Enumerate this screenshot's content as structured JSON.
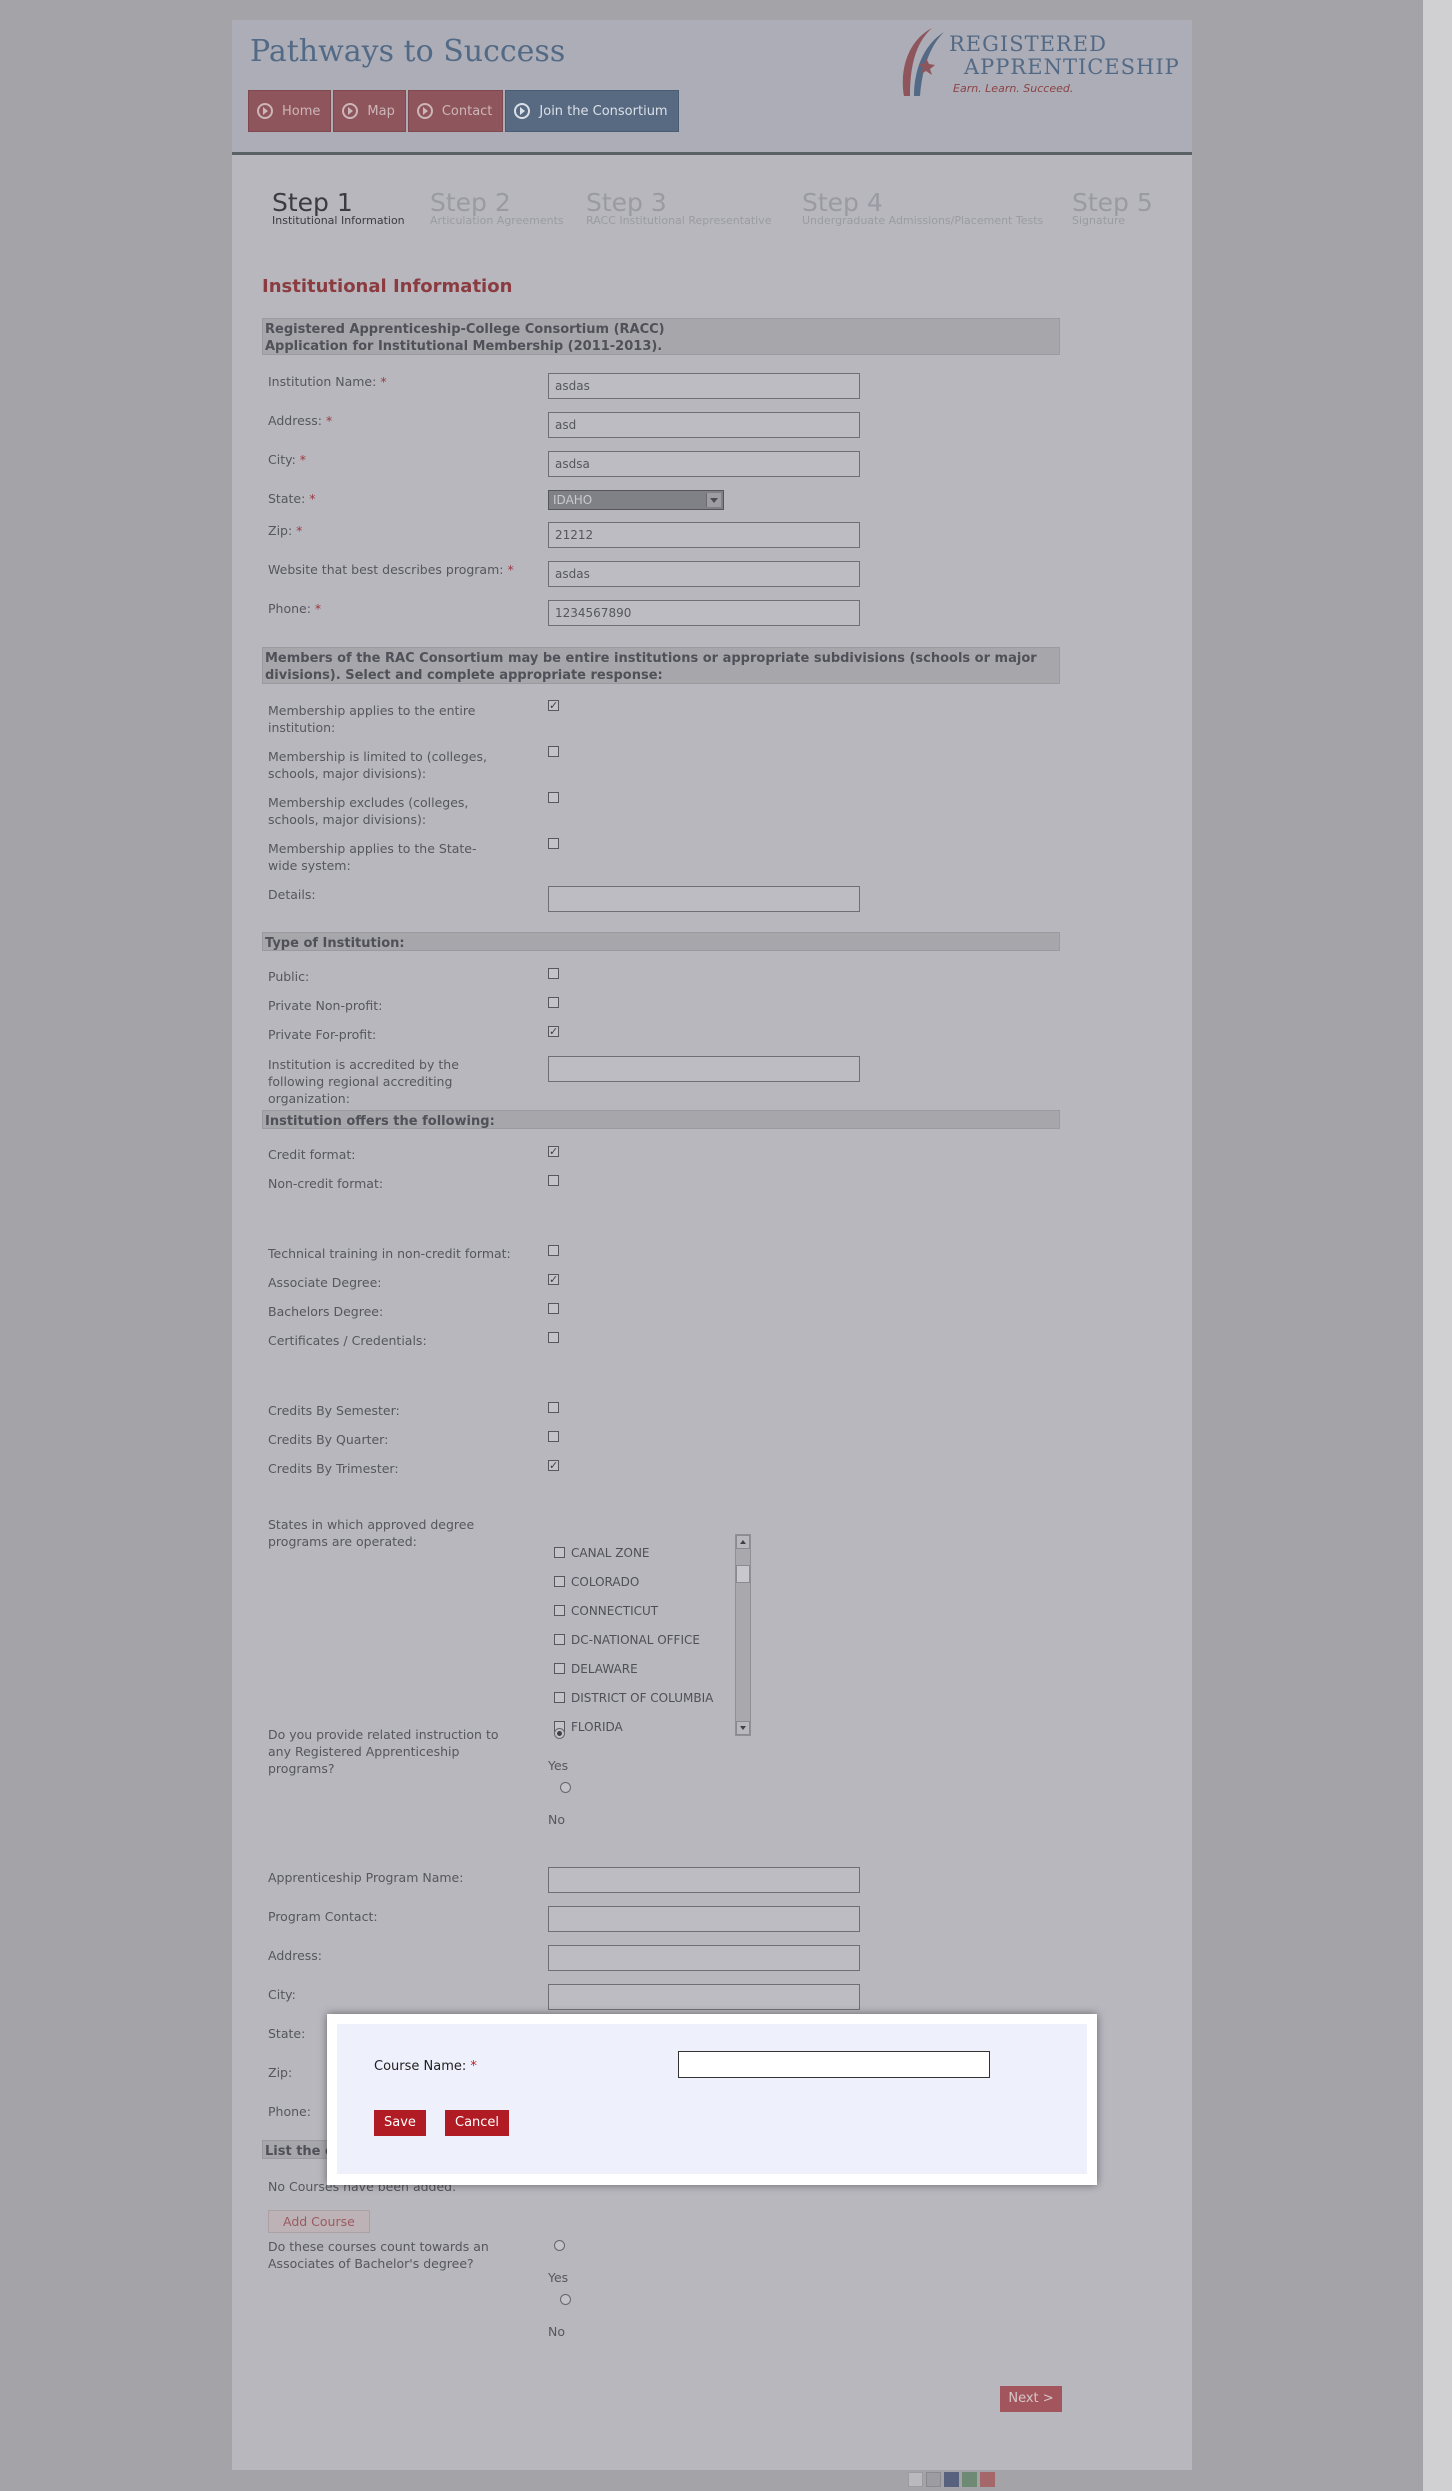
{
  "site": {
    "title": "Pathways to Success"
  },
  "logo": {
    "line1": "REGISTERED",
    "line2": "APPRENTICESHIP",
    "tagline": "Earn. Learn. Succeed."
  },
  "nav": [
    {
      "label": "Home"
    },
    {
      "label": "Map"
    },
    {
      "label": "Contact"
    },
    {
      "label": "Join the Consortium"
    }
  ],
  "steps": [
    {
      "title": "Step 1",
      "sub": "Institutional Information"
    },
    {
      "title": "Step 2",
      "sub": "Articulation Agreements"
    },
    {
      "title": "Step 3",
      "sub": "RACC Institutional Representative"
    },
    {
      "title": "Step 4",
      "sub": "Undergraduate Admissions/Placement Tests"
    },
    {
      "title": "Step 5",
      "sub": "Signature"
    }
  ],
  "form": {
    "heading": "Institutional Information",
    "section1": {
      "line1": "Registered Apprenticeship-College Consortium (RACC)",
      "line2": "Application for Institutional Membership (2011-2013)."
    },
    "institution_name": {
      "label": "Institution Name:",
      "value": "asdas"
    },
    "address": {
      "label": "Address:",
      "value": "asd"
    },
    "city": {
      "label": "City:",
      "value": "asdsa"
    },
    "state": {
      "label": "State:",
      "value": "IDAHO"
    },
    "zip": {
      "label": "Zip:",
      "value": "21212"
    },
    "website": {
      "label": "Website that best describes program:",
      "value": "asdas"
    },
    "phone": {
      "label": "Phone:",
      "value": "1234567890"
    },
    "req_mark": "*",
    "section2": "Members of the RAC Consortium may be entire institutions or appropriate subdivisions (schools or major divisions). Select and complete appropriate response:",
    "membership": [
      {
        "label": "Membership applies to the entire institution:",
        "checked": "✓"
      },
      {
        "label": "Membership is limited to (colleges, schools, major divisions):",
        "checked": ""
      },
      {
        "label": "Membership excludes (colleges, schools, major divisions):",
        "checked": ""
      },
      {
        "label": "Membership applies to the State-wide system:",
        "checked": ""
      }
    ],
    "details": {
      "label": "Details:",
      "value": ""
    },
    "section3": "Type of Institution:",
    "type": [
      {
        "label": "Public:",
        "checked": ""
      },
      {
        "label": "Private Non-profit:",
        "checked": ""
      },
      {
        "label": "Private For-profit:",
        "checked": "✓"
      }
    ],
    "accredited": {
      "label": "Institution is accredited by the following regional accrediting organization:",
      "value": ""
    },
    "section4": "Institution offers the following:",
    "format": [
      {
        "label": "Credit format:",
        "checked": "✓"
      },
      {
        "label": "Non-credit format:",
        "checked": ""
      }
    ],
    "degrees": [
      {
        "label": "Technical training in non-credit format:",
        "checked": ""
      },
      {
        "label": "Associate Degree:",
        "checked": "✓"
      },
      {
        "label": "Bachelors Degree:",
        "checked": ""
      },
      {
        "label": "Certificates / Credentials:",
        "checked": ""
      }
    ],
    "credits": [
      {
        "label": "Credits By Semester:",
        "checked": ""
      },
      {
        "label": "Credits By Quarter:",
        "checked": ""
      },
      {
        "label": "Credits By Trimester:",
        "checked": "✓"
      }
    ],
    "states_label": "States in which approved degree programs are operated:",
    "states": [
      "CANAL ZONE",
      "COLORADO",
      "CONNECTICUT",
      "DC-NATIONAL OFFICE",
      "DELAWARE",
      "DISTRICT OF COLUMBIA",
      "FLORIDA"
    ],
    "related_q": "Do you provide related instruction to any Registered Apprenticeship programs?",
    "yes": "Yes",
    "no": "No",
    "program": [
      {
        "label": "Apprenticeship Program Name:",
        "value": ""
      },
      {
        "label": "Program Contact:",
        "value": ""
      },
      {
        "label": "Address:",
        "value": ""
      },
      {
        "label": "City:",
        "value": ""
      },
      {
        "label": "State:"
      },
      {
        "label": "Zip:"
      },
      {
        "label": "Phone:"
      }
    ],
    "list_section": "List the c",
    "no_courses": "No Courses have been added.",
    "add_course": "Add Course",
    "count_q": "Do these courses count towards an Associates of Bachelor's degree?",
    "next": "Next >"
  },
  "modal": {
    "course_label": "Course Name:",
    "course_value": "",
    "save": "Save",
    "cancel": "Cancel"
  },
  "colors": {
    "accent_red": "#b11b24",
    "nav_active": "#576a82",
    "header_text": "#536a86"
  }
}
